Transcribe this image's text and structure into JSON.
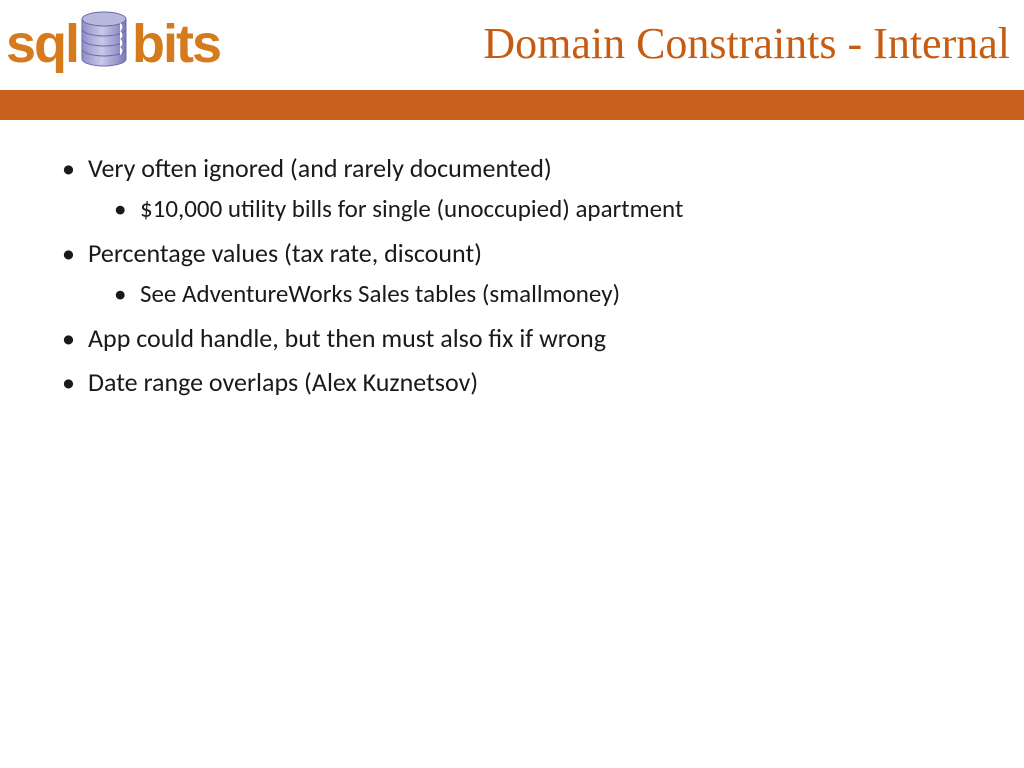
{
  "logo": {
    "left": "sql",
    "right": "bits"
  },
  "title": "Domain Constraints - Internal",
  "bullets": [
    {
      "text": "Very often ignored (and rarely documented)",
      "sub": [
        "$10,000 utility bills for single (unoccupied) apartment"
      ]
    },
    {
      "text": "Percentage values (tax rate, discount)",
      "sub": [
        "See AdventureWorks Sales tables (smallmoney)"
      ]
    },
    {
      "text": "App could handle, but then must also fix if wrong",
      "sub": []
    },
    {
      "text": "Date range overlaps (Alex Kuznetsov)",
      "sub": []
    }
  ]
}
